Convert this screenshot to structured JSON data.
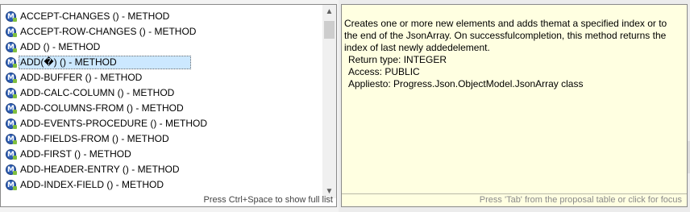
{
  "proposals": {
    "items": [
      {
        "label": "ACCEPT-CHANGES () - METHOD"
      },
      {
        "label": "ACCEPT-ROW-CHANGES () - METHOD"
      },
      {
        "label": "ADD () - METHOD"
      },
      {
        "label": "ADD(�) () - METHOD",
        "selected": true
      },
      {
        "label": "ADD-BUFFER () - METHOD"
      },
      {
        "label": "ADD-CALC-COLUMN () - METHOD"
      },
      {
        "label": "ADD-COLUMNS-FROM () - METHOD"
      },
      {
        "label": "ADD-EVENTS-PROCEDURE () - METHOD"
      },
      {
        "label": "ADD-FIELDS-FROM () - METHOD"
      },
      {
        "label": "ADD-FIRST () - METHOD"
      },
      {
        "label": "ADD-HEADER-ENTRY () - METHOD"
      },
      {
        "label": "ADD-INDEX-FIELD () - METHOD"
      }
    ],
    "hint": "Press Ctrl+Space to show full list",
    "icon": "method-icon"
  },
  "doc": {
    "description": "Creates one or more new elements and adds themat a specified index or to the end of the JsonArray. On successfulcompletion, this method returns the index of last newly addedelement.",
    "return_type": "Return type: INTEGER",
    "access": "Access: PUBLIC",
    "applies_to": "Appliesto:  Progress.Json.ObjectModel.JsonArray class",
    "footer": "Press 'Tab' from the proposal table or click for focus"
  },
  "colors": {
    "selection": "#cce8ff",
    "doc_background": "#ffffe1",
    "method_icon": "#2f5fb5"
  }
}
